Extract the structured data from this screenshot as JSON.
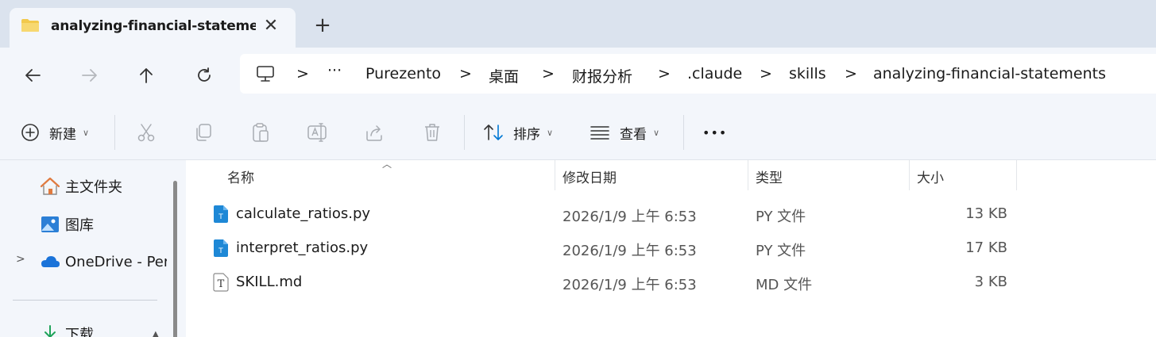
{
  "tab": {
    "title": "analyzing-financial-statements",
    "close_glyph": "✕",
    "new_tab_glyph": "+"
  },
  "nav": {
    "icons": [
      "back-arrow-icon",
      "forward-arrow-icon",
      "up-arrow-icon",
      "refresh-icon"
    ],
    "breadcrumb": {
      "overflow": "···",
      "items": [
        "Purezento",
        "桌面",
        "财报分析",
        ".claude",
        "skills",
        "analyzing-financial-statements"
      ],
      "separator": ">"
    }
  },
  "toolbar": {
    "new_label": "新建",
    "sort_label": "排序",
    "view_label": "查看",
    "more_glyph": "•••"
  },
  "sidebar": {
    "items": [
      {
        "label": "主文件夹",
        "icon": "home-icon"
      },
      {
        "label": "图库",
        "icon": "gallery-icon"
      },
      {
        "label": "OneDrive - Per",
        "icon": "cloud-icon"
      },
      {
        "label": "下载",
        "icon": "download-icon"
      }
    ]
  },
  "files": {
    "columns": {
      "name": "名称",
      "modified": "修改日期",
      "type": "类型",
      "size": "大小"
    },
    "rows": [
      {
        "name": "calculate_ratios.py",
        "modified": "2026/1/9 上午 6:53",
        "type": "PY 文件",
        "size": "13 KB",
        "icon": "python-file-icon"
      },
      {
        "name": "interpret_ratios.py",
        "modified": "2026/1/9 上午 6:53",
        "type": "PY 文件",
        "size": "17 KB",
        "icon": "python-file-icon"
      },
      {
        "name": "SKILL.md",
        "modified": "2026/1/9 上午 6:53",
        "type": "MD 文件",
        "size": "3 KB",
        "icon": "text-file-icon"
      }
    ]
  },
  "colors": {
    "chrome": "#f3f6fb",
    "tabstrip": "#dbe3ee",
    "accent": "#0078d4",
    "folder": "#f2c94c"
  }
}
